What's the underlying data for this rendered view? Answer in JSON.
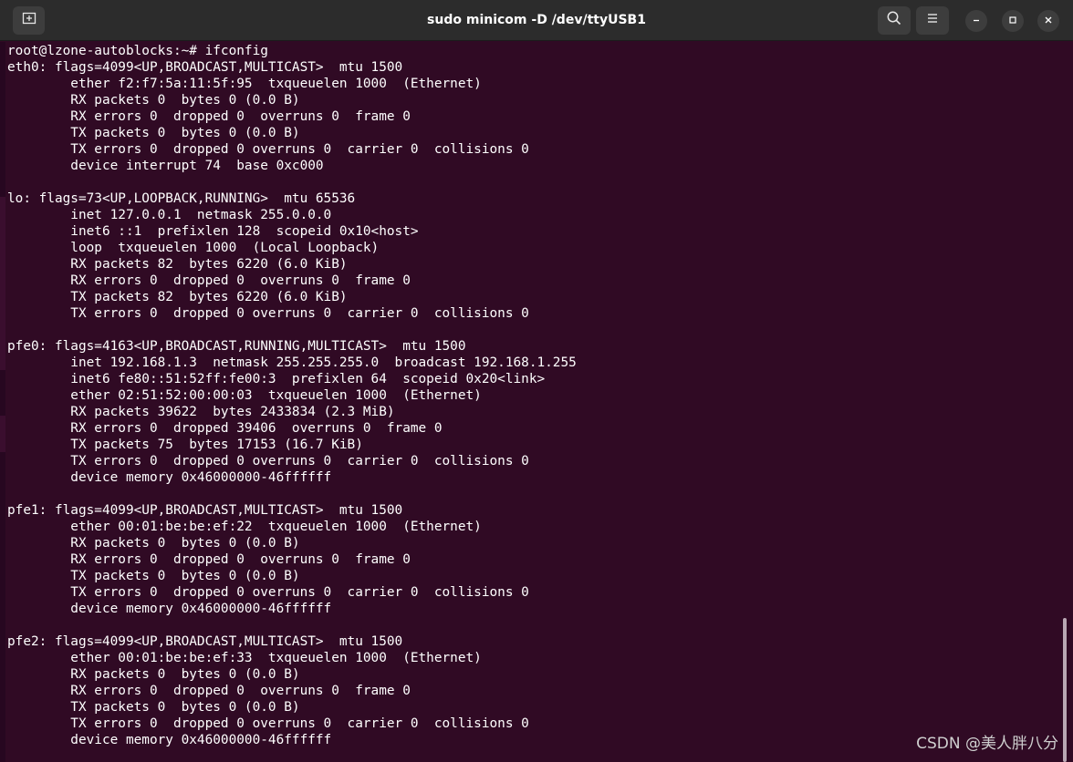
{
  "window": {
    "title": "sudo minicom -D /dev/ttyUSB1"
  },
  "titlebar": {
    "new_tab_icon": "new-tab-icon",
    "search_icon": "search-icon",
    "menu_icon": "hamburger-menu-icon",
    "minimize_icon": "minimize-icon",
    "maximize_icon": "maximize-icon",
    "close_icon": "close-icon"
  },
  "terminal": {
    "lines": [
      "root@lzone-autoblocks:~# ifconfig",
      "eth0: flags=4099<UP,BROADCAST,MULTICAST>  mtu 1500",
      "        ether f2:f7:5a:11:5f:95  txqueuelen 1000  (Ethernet)",
      "        RX packets 0  bytes 0 (0.0 B)",
      "        RX errors 0  dropped 0  overruns 0  frame 0",
      "        TX packets 0  bytes 0 (0.0 B)",
      "        TX errors 0  dropped 0 overruns 0  carrier 0  collisions 0",
      "        device interrupt 74  base 0xc000",
      "",
      "lo: flags=73<UP,LOOPBACK,RUNNING>  mtu 65536",
      "        inet 127.0.0.1  netmask 255.0.0.0",
      "        inet6 ::1  prefixlen 128  scopeid 0x10<host>",
      "        loop  txqueuelen 1000  (Local Loopback)",
      "        RX packets 82  bytes 6220 (6.0 KiB)",
      "        RX errors 0  dropped 0  overruns 0  frame 0",
      "        TX packets 82  bytes 6220 (6.0 KiB)",
      "        TX errors 0  dropped 0 overruns 0  carrier 0  collisions 0",
      "",
      "pfe0: flags=4163<UP,BROADCAST,RUNNING,MULTICAST>  mtu 1500",
      "        inet 192.168.1.3  netmask 255.255.255.0  broadcast 192.168.1.255",
      "        inet6 fe80::51:52ff:fe00:3  prefixlen 64  scopeid 0x20<link>",
      "        ether 02:51:52:00:00:03  txqueuelen 1000  (Ethernet)",
      "        RX packets 39622  bytes 2433834 (2.3 MiB)",
      "        RX errors 0  dropped 39406  overruns 0  frame 0",
      "        TX packets 75  bytes 17153 (16.7 KiB)",
      "        TX errors 0  dropped 0 overruns 0  carrier 0  collisions 0",
      "        device memory 0x46000000-46ffffff",
      "",
      "pfe1: flags=4099<UP,BROADCAST,MULTICAST>  mtu 1500",
      "        ether 00:01:be:be:ef:22  txqueuelen 1000  (Ethernet)",
      "        RX packets 0  bytes 0 (0.0 B)",
      "        RX errors 0  dropped 0  overruns 0  frame 0",
      "        TX packets 0  bytes 0 (0.0 B)",
      "        TX errors 0  dropped 0 overruns 0  carrier 0  collisions 0",
      "        device memory 0x46000000-46ffffff",
      "",
      "pfe2: flags=4099<UP,BROADCAST,MULTICAST>  mtu 1500",
      "        ether 00:01:be:be:ef:33  txqueuelen 1000  (Ethernet)",
      "        RX packets 0  bytes 0 (0.0 B)",
      "        RX errors 0  dropped 0  overruns 0  frame 0",
      "        TX packets 0  bytes 0 (0.0 B)",
      "        TX errors 0  dropped 0 overruns 0  carrier 0  collisions 0",
      "        device memory 0x46000000-46ffffff"
    ]
  },
  "watermark": "CSDN @美人胖八分",
  "colors": {
    "terminal_bg": "#300a24",
    "titlebar_bg": "#2c2c2c",
    "text": "#ffffff"
  }
}
